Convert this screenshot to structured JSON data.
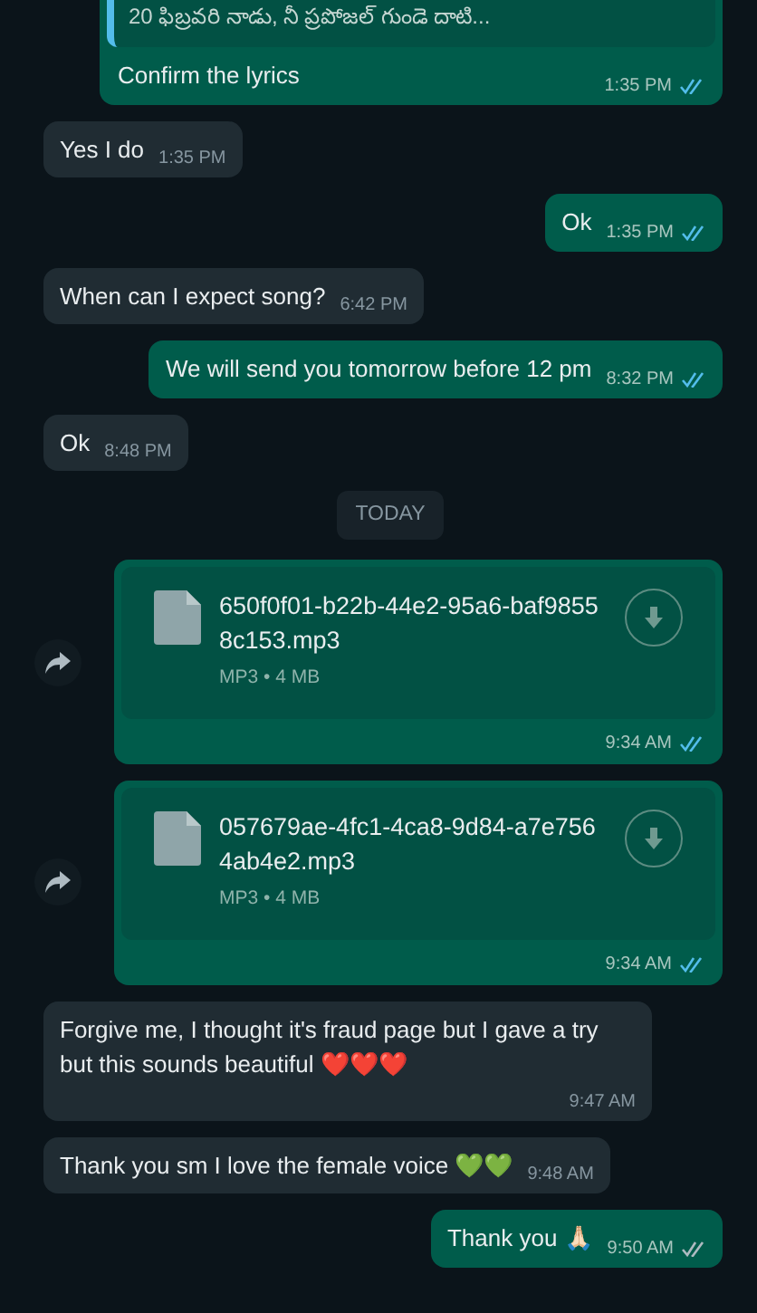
{
  "messages": [
    {
      "kind": "quote",
      "outgoing": true,
      "quote": "20 ఫిబ్రవరి నాడు, నీ ప్రపోజల్ గుండె దాటి...",
      "text": "Confirm the lyrics",
      "time": "1:35 PM",
      "read": true
    },
    {
      "kind": "text",
      "outgoing": false,
      "text": "Yes I do",
      "time": "1:35 PM"
    },
    {
      "kind": "text",
      "outgoing": true,
      "text": "Ok",
      "time": "1:35 PM",
      "read": true
    },
    {
      "kind": "text",
      "outgoing": false,
      "text": "When can I expect song?",
      "time": "6:42 PM"
    },
    {
      "kind": "text",
      "outgoing": true,
      "text": "We will send you tomorrow before 12 pm",
      "time": "8:32 PM",
      "read": true
    },
    {
      "kind": "text",
      "outgoing": false,
      "text": "Ok",
      "time": "8:48 PM"
    },
    {
      "kind": "date",
      "text": "TODAY"
    },
    {
      "kind": "file",
      "outgoing": true,
      "name": "650f0f01-b22b-44e2-95a6-baf98558c153.mp3",
      "meta": "MP3 • 4 MB",
      "time": "9:34 AM",
      "read": true
    },
    {
      "kind": "file",
      "outgoing": true,
      "name": "057679ae-4fc1-4ca8-9d84-a7e7564ab4e2.mp3",
      "meta": "MP3 • 4 MB",
      "time": "9:34 AM",
      "read": true
    },
    {
      "kind": "text",
      "outgoing": false,
      "text": "Forgive me, I thought it's fraud page but I gave a try but this sounds beautiful ❤️❤️❤️",
      "time": "9:47 AM"
    },
    {
      "kind": "text",
      "outgoing": false,
      "text": "Thank you sm I love the female voice 💚💚",
      "time": "9:48 AM"
    },
    {
      "kind": "text",
      "outgoing": true,
      "text": "Thank you 🙏🏻",
      "time": "9:50 AM",
      "read": false
    }
  ]
}
